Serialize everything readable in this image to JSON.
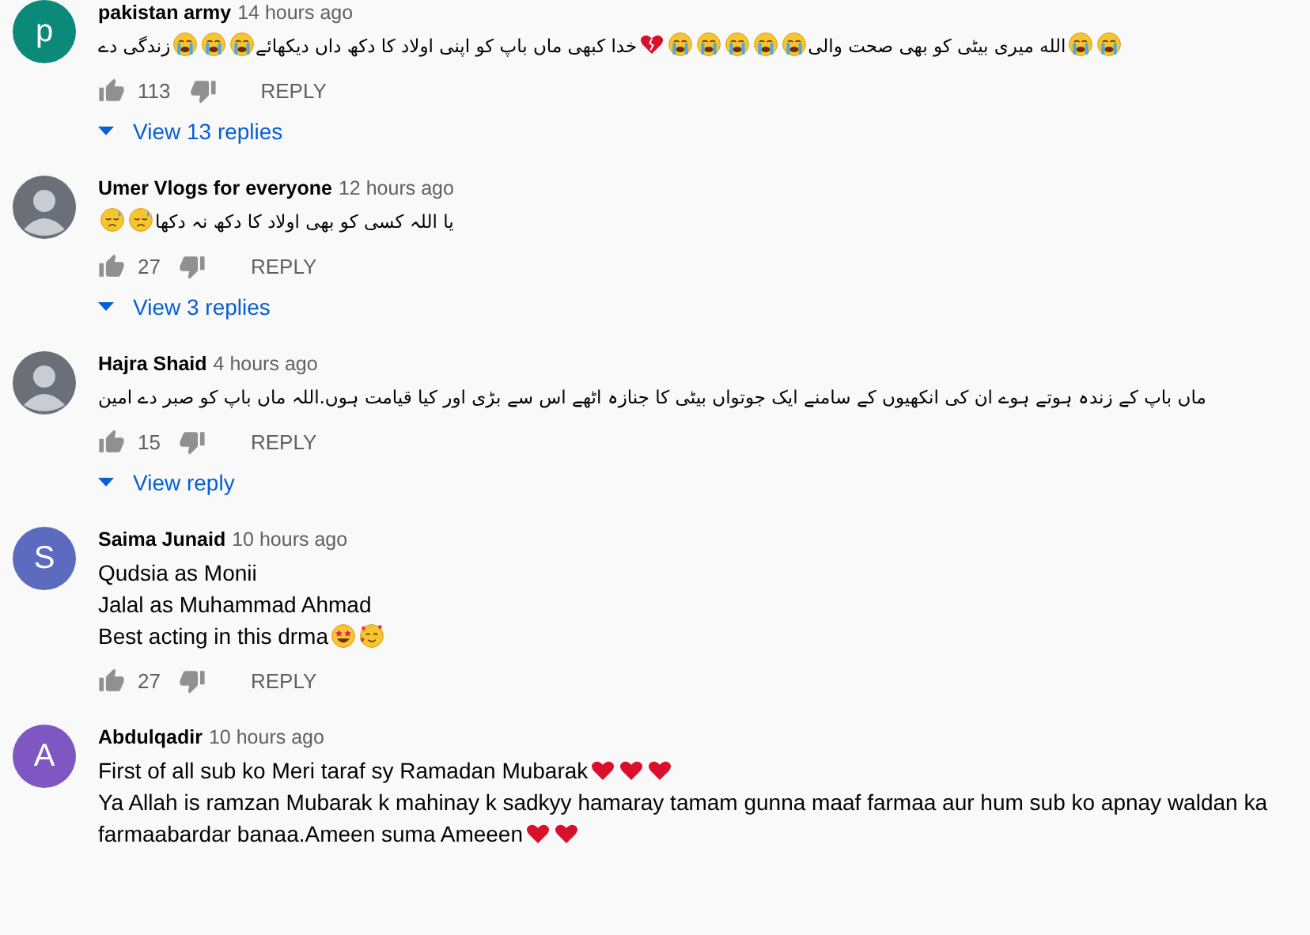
{
  "comments": [
    {
      "author": "pakistan army",
      "time": "14 hours ago",
      "avatar": {
        "kind": "letter",
        "letter": "p",
        "color": "#0b8a7a"
      },
      "rtl": true,
      "lines": [
        [
          {
            "kind": "crying"
          },
          {
            "kind": "crying"
          },
          {
            "kind": "text",
            "text": "الله میری بیٹی کو بھی صحت والی"
          },
          {
            "kind": "crying"
          },
          {
            "kind": "crying"
          },
          {
            "kind": "crying"
          },
          {
            "kind": "crying"
          },
          {
            "kind": "crying"
          },
          {
            "kind": "broken_heart"
          },
          {
            "kind": "text",
            "text": "خدا کبھی ماں باپ کو اپنی اولاد کا دکھ داں دیکھائے"
          },
          {
            "kind": "crying"
          },
          {
            "kind": "crying"
          },
          {
            "kind": "crying"
          },
          {
            "kind": "text",
            "text": "زندگی دے"
          }
        ]
      ],
      "likes": "113",
      "reply": "REPLY",
      "replies": "View 13 replies"
    },
    {
      "author": "Umer Vlogs for everyone",
      "time": "12 hours ago",
      "avatar": {
        "kind": "photo"
      },
      "rtl": true,
      "lines": [
        [
          {
            "kind": "text",
            "text": "یا اللہ کسی کو بھی اولاد کا دکھ نہ دکھا"
          },
          {
            "kind": "sad"
          },
          {
            "kind": "sad"
          }
        ]
      ],
      "likes": "27",
      "reply": "REPLY",
      "replies": "View 3 replies"
    },
    {
      "author": "Hajra Shaid",
      "time": "4 hours ago",
      "avatar": {
        "kind": "photo"
      },
      "rtl": true,
      "lines": [
        [
          {
            "kind": "text",
            "text": "ماں باپ کے زندہ ہوتے ہوے  ان  کی انکھیوں کے سامنے ایک جوتواں  بیٹی کا جنازہ اٹھے اس  سے بڑی اور کیا قیامت ہوں.اللہ ماں باپ کو صبر دے امین"
          }
        ]
      ],
      "likes": "15",
      "reply": "REPLY",
      "replies": "View reply"
    },
    {
      "author": "Saima Junaid",
      "time": "10 hours ago",
      "avatar": {
        "kind": "letter",
        "letter": "S",
        "color": "#5c6bc0"
      },
      "rtl": false,
      "lines": [
        [
          {
            "kind": "text",
            "text": "Qudsia as Monii"
          }
        ],
        [
          {
            "kind": "text",
            "text": "Jalal as Muhammad Ahmad"
          }
        ],
        [
          {
            "kind": "text",
            "text": "Best acting in this drma"
          },
          {
            "kind": "star_eyes"
          },
          {
            "kind": "hearts_face"
          }
        ]
      ],
      "likes": "27",
      "reply": "REPLY"
    },
    {
      "author": "Abdulqadir",
      "time": "10 hours ago",
      "avatar": {
        "kind": "letter",
        "letter": "A",
        "color": "#7e57c2"
      },
      "rtl": false,
      "lines": [
        [
          {
            "kind": "text",
            "text": "First of all sub ko Meri taraf sy Ramadan Mubarak"
          },
          {
            "kind": "heart"
          },
          {
            "kind": "heart"
          },
          {
            "kind": "heart"
          }
        ],
        [
          {
            "kind": "text",
            "text": "Ya Allah is ramzan Mubarak k mahinay k sadkyy hamaray tamam gunna maaf farmaa aur hum sub ko apnay waldan ka farmaabardar banaa.Ameen suma Ameeen"
          },
          {
            "kind": "heart"
          },
          {
            "kind": "heart"
          }
        ]
      ]
    }
  ]
}
